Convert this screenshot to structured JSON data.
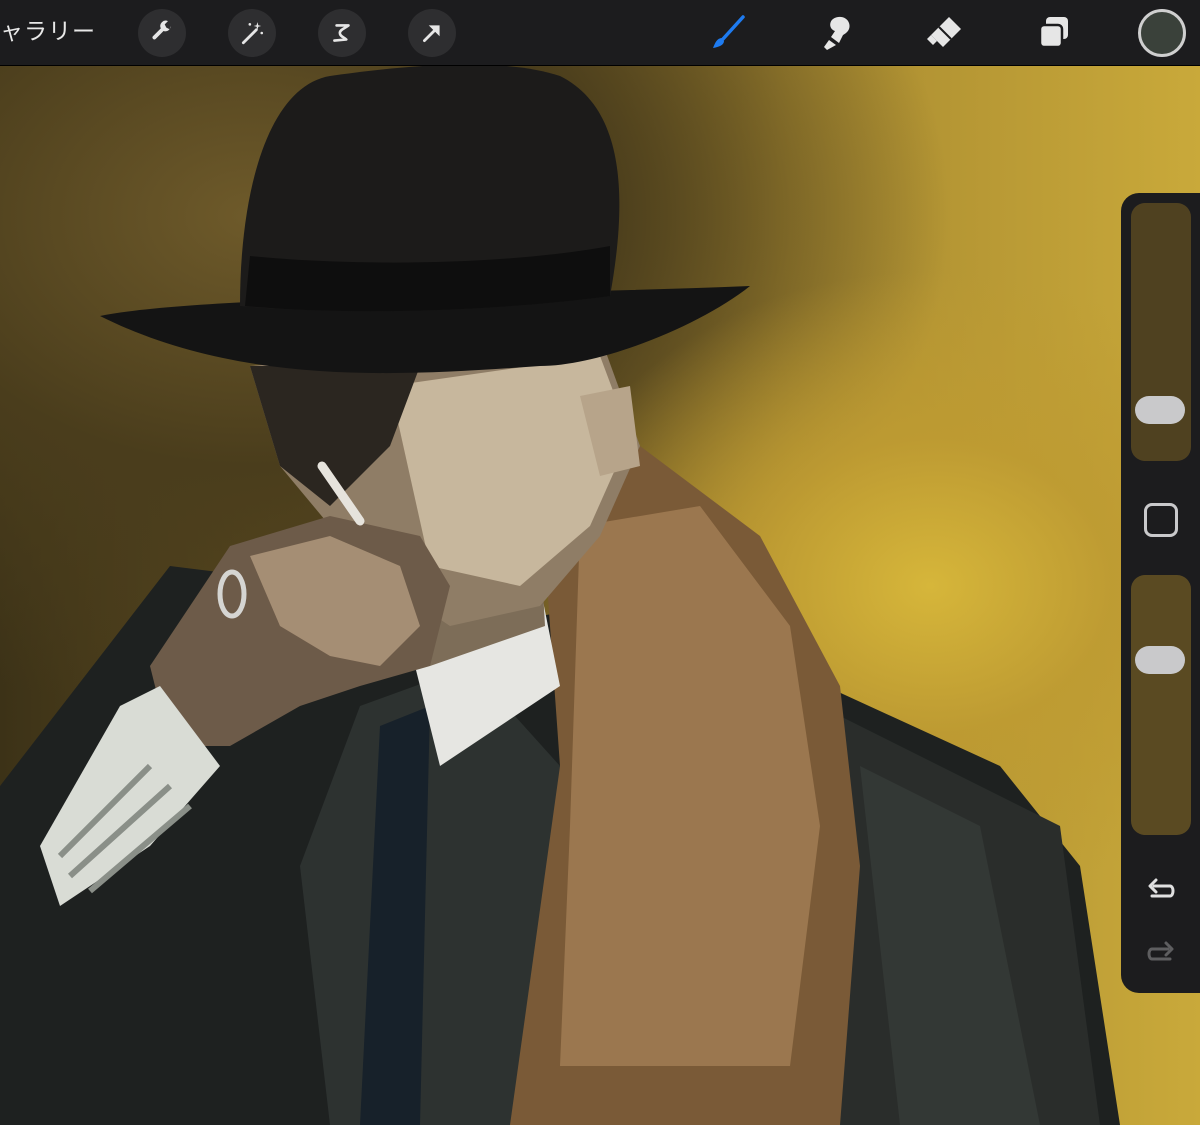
{
  "toolbar": {
    "gallery_label": "ギャラリー",
    "left_tools": [
      {
        "icon": "wrench-icon",
        "name": "actions"
      },
      {
        "icon": "magic-wand-icon",
        "name": "adjustments"
      },
      {
        "icon": "selection-icon",
        "name": "selection"
      },
      {
        "icon": "arrow-cursor-icon",
        "name": "transform"
      }
    ],
    "right_tools": [
      {
        "icon": "brush-icon",
        "name": "paint",
        "active": true
      },
      {
        "icon": "smudge-icon",
        "name": "smudge",
        "active": false
      },
      {
        "icon": "eraser-icon",
        "name": "erase",
        "active": false
      },
      {
        "icon": "layers-icon",
        "name": "layers",
        "active": false
      }
    ],
    "current_color": "#3a413a",
    "active_color": "#1e7bf0"
  },
  "sidebar": {
    "brush_size_track_color": "#4f4120",
    "opacity_track_color": "#5a4a22",
    "brush_size_level": 0.15,
    "opacity_level": 0.7
  }
}
